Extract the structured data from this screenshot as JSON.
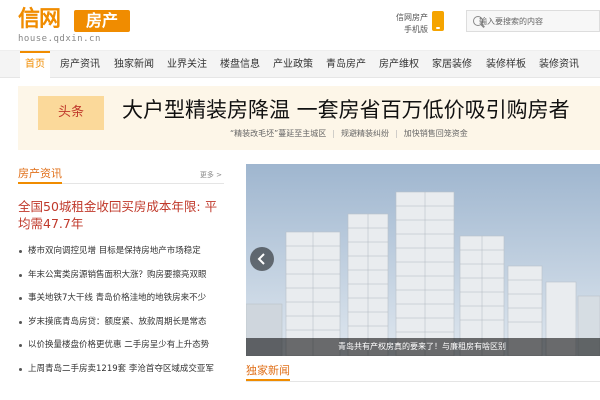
{
  "header": {
    "logo_main": "信网",
    "logo_box": "房产",
    "logo_url": "house.qdxin.cn",
    "mobile_line1": "信网房产",
    "mobile_line2": "手机版",
    "search_placeholder": "输入要搜索的内容",
    "accent_color": "#f08c00"
  },
  "nav": {
    "items": [
      {
        "label": "首页",
        "active": true
      },
      {
        "label": "房产资讯"
      },
      {
        "label": "独家新闻"
      },
      {
        "label": "业界关注"
      },
      {
        "label": "楼盘信息"
      },
      {
        "label": "产业政策"
      },
      {
        "label": "青岛房产"
      },
      {
        "label": "房产维权"
      },
      {
        "label": "家居装修"
      },
      {
        "label": "装修样板"
      },
      {
        "label": "装修资讯"
      }
    ]
  },
  "headline": {
    "badge": "头条",
    "title": "大户型精装房降温 一套房省百万低价吸引购房者",
    "subs": [
      "“精装改毛坯”蔓延至主城区",
      "规避精装纠纷",
      "加快销售回笼资金"
    ]
  },
  "news": {
    "section_title": "房产资讯",
    "more": "更多 >",
    "lead": "全国50城租金收回买房成本年限: 平均需47.7年",
    "items": [
      "楼市双向调控见增 目标是保持房地产市场稳定",
      "年末公寓类房源销售面积大涨？购房要擦亮双眼",
      "事关地铁7大干线 青岛价格洼地的地铁房来不少",
      "岁末摸底青岛房贷：额度紧、放款周期长是常态",
      "以价换量楼盘价格更优惠 二手房呈少有上升态势",
      "上周青岛二手房卖1219套 李沧首夺区域成交亚军"
    ]
  },
  "carousel": {
    "caption": "青岛共有产权房真的要来了！与廉租房有啥区别",
    "prev_icon": "chevron-left-icon"
  },
  "exclusive": {
    "section_title": "独家新闻"
  }
}
